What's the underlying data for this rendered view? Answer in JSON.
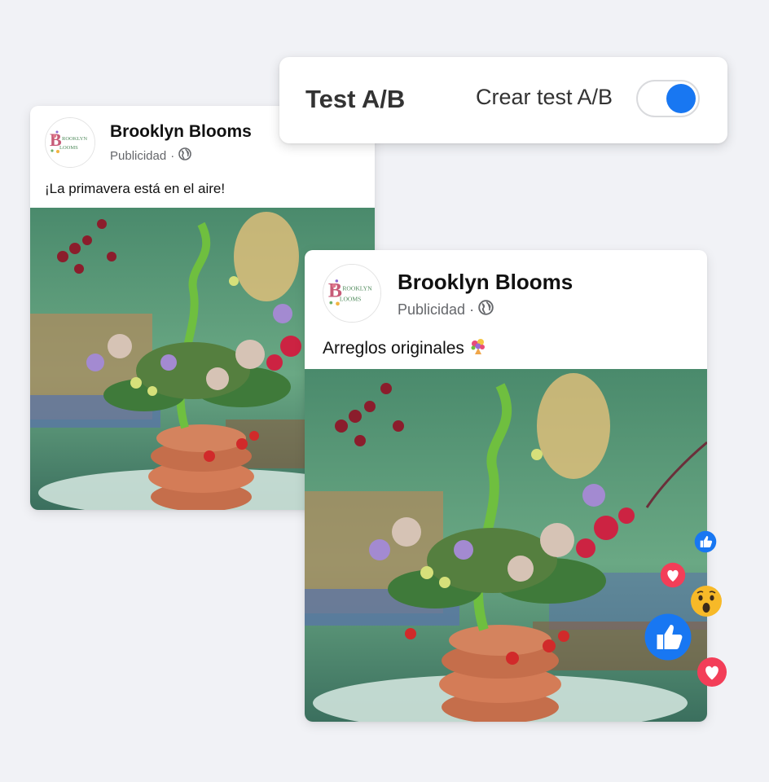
{
  "ab_test": {
    "title": "Test A/B",
    "toggle_label": "Crear test A/B",
    "toggle_on": true,
    "accent_color": "#1877f2"
  },
  "post_a": {
    "page_name": "Brooklyn Blooms",
    "sponsored": "Publicidad",
    "caption": "¡La primavera está en el aire!"
  },
  "post_b": {
    "page_name": "Brooklyn Blooms",
    "sponsored": "Publicidad",
    "caption": "Arreglos originales"
  },
  "logo_text": [
    "ROOKLYN",
    "LOOMS"
  ],
  "reactions": [
    "like-icon",
    "love-icon",
    "wow-icon",
    "like-icon",
    "love-icon"
  ]
}
